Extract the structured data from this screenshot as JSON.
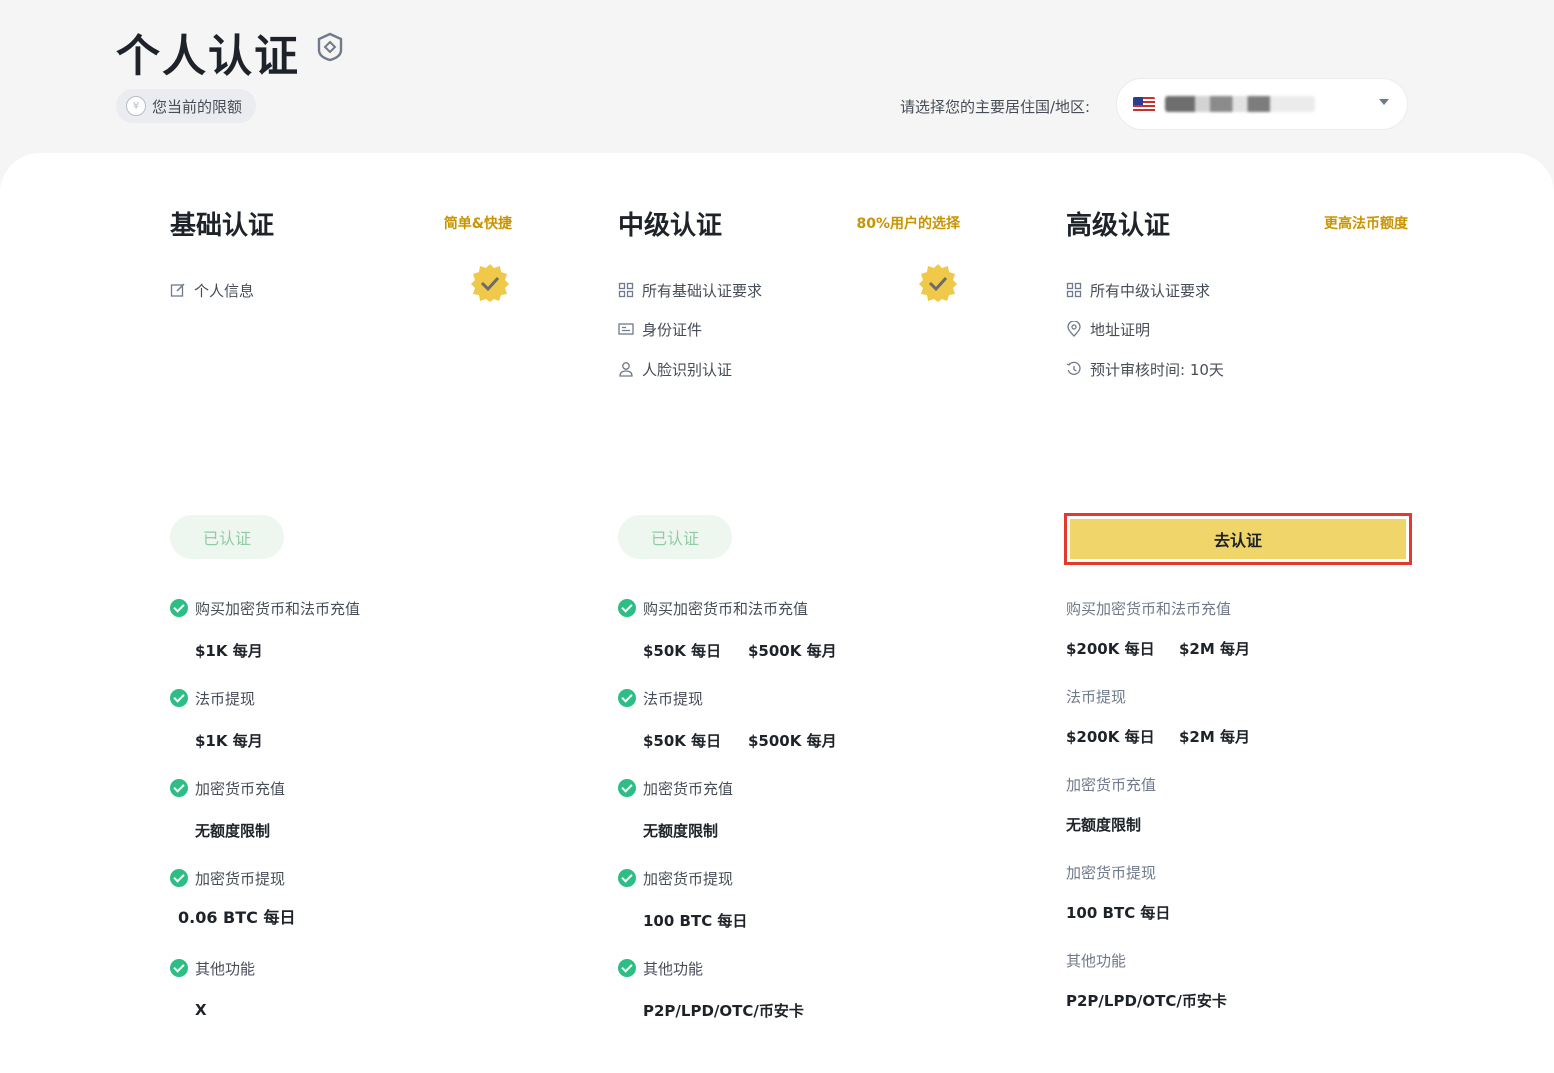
{
  "header": {
    "title": "个人认证",
    "limit_pill": "您当前的限额",
    "region_label": "请选择您的主要居住国/地区:"
  },
  "colors": {
    "accent": "#c99400",
    "success": "#2ebd85",
    "button_yellow": "#f0d56b",
    "highlight_border": "#e03b2c"
  },
  "tiers": [
    {
      "title": "基础认证",
      "tag": "简单&快捷",
      "requirements": [
        {
          "icon": "edit-icon",
          "text": "个人信息"
        }
      ],
      "status_label": "已认证",
      "limits": [
        {
          "label": "购买加密货币和法币充值",
          "values": [
            "$1K 每月"
          ]
        },
        {
          "label": "法币提现",
          "values": [
            "$1K 每月"
          ]
        },
        {
          "label": "加密货币充值",
          "values": [
            "无额度限制"
          ]
        },
        {
          "label": "加密货币提现",
          "values": [
            "0.06 BTC 每日"
          ]
        },
        {
          "label": "其他功能",
          "values": [
            "X"
          ]
        }
      ]
    },
    {
      "title": "中级认证",
      "tag": "80%用户的选择",
      "requirements": [
        {
          "icon": "grid-icon",
          "text": "所有基础认证要求"
        },
        {
          "icon": "id-card-icon",
          "text": "身份证件"
        },
        {
          "icon": "person-icon",
          "text": "人脸识别认证"
        }
      ],
      "status_label": "已认证",
      "limits": [
        {
          "label": "购买加密货币和法币充值",
          "values": [
            "$50K 每日",
            "$500K 每月"
          ]
        },
        {
          "label": "法币提现",
          "values": [
            "$50K 每日",
            "$500K 每月"
          ]
        },
        {
          "label": "加密货币充值",
          "values": [
            "无额度限制"
          ]
        },
        {
          "label": "加密货币提现",
          "values": [
            "100 BTC 每日"
          ]
        },
        {
          "label": "其他功能",
          "values": [
            "P2P/LPD/OTC/币安卡"
          ]
        }
      ]
    },
    {
      "title": "高级认证",
      "tag": "更高法币额度",
      "requirements": [
        {
          "icon": "grid-icon",
          "text": "所有中级认证要求"
        },
        {
          "icon": "location-pin-icon",
          "text": "地址证明"
        },
        {
          "icon": "clock-icon",
          "text": "预计审核时间: 10天"
        }
      ],
      "action_label": "去认证",
      "limits": [
        {
          "label": "购买加密货币和法币充值",
          "values": [
            "$200K 每日",
            "$2M 每月"
          ]
        },
        {
          "label": "法币提现",
          "values": [
            "$200K 每日",
            "$2M 每月"
          ]
        },
        {
          "label": "加密货币充值",
          "values": [
            "无额度限制"
          ]
        },
        {
          "label": "加密货币提现",
          "values": [
            "100 BTC 每日"
          ]
        },
        {
          "label": "其他功能",
          "values": [
            "P2P/LPD/OTC/币安卡"
          ]
        }
      ]
    }
  ]
}
